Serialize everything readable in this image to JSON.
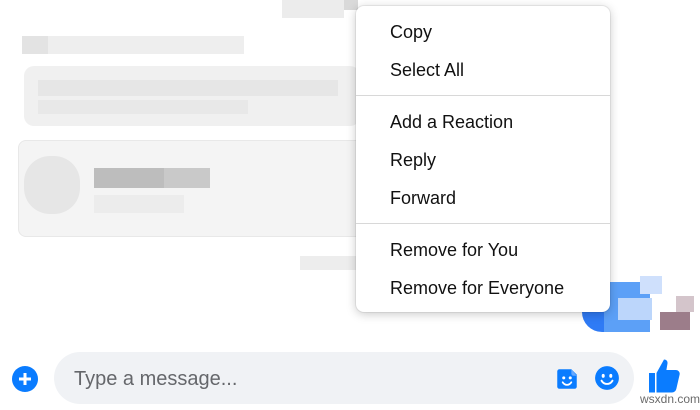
{
  "context_menu": {
    "groups": [
      [
        "Copy",
        "Select All"
      ],
      [
        "Add a Reaction",
        "Reply",
        "Forward"
      ],
      [
        "Remove for You",
        "Remove for Everyone"
      ]
    ]
  },
  "composer": {
    "placeholder": "Type a message...",
    "icons": {
      "add": "plus-circle-icon",
      "sticker": "sticker-icon",
      "emoji": "emoji-icon",
      "like": "thumbs-up-icon"
    }
  },
  "colors": {
    "accent": "#0a7cff",
    "own_bubble": "#2f7bf5",
    "input_background": "#f0f2f5",
    "menu_text": "#111111"
  },
  "watermark": "wsxdn.com"
}
